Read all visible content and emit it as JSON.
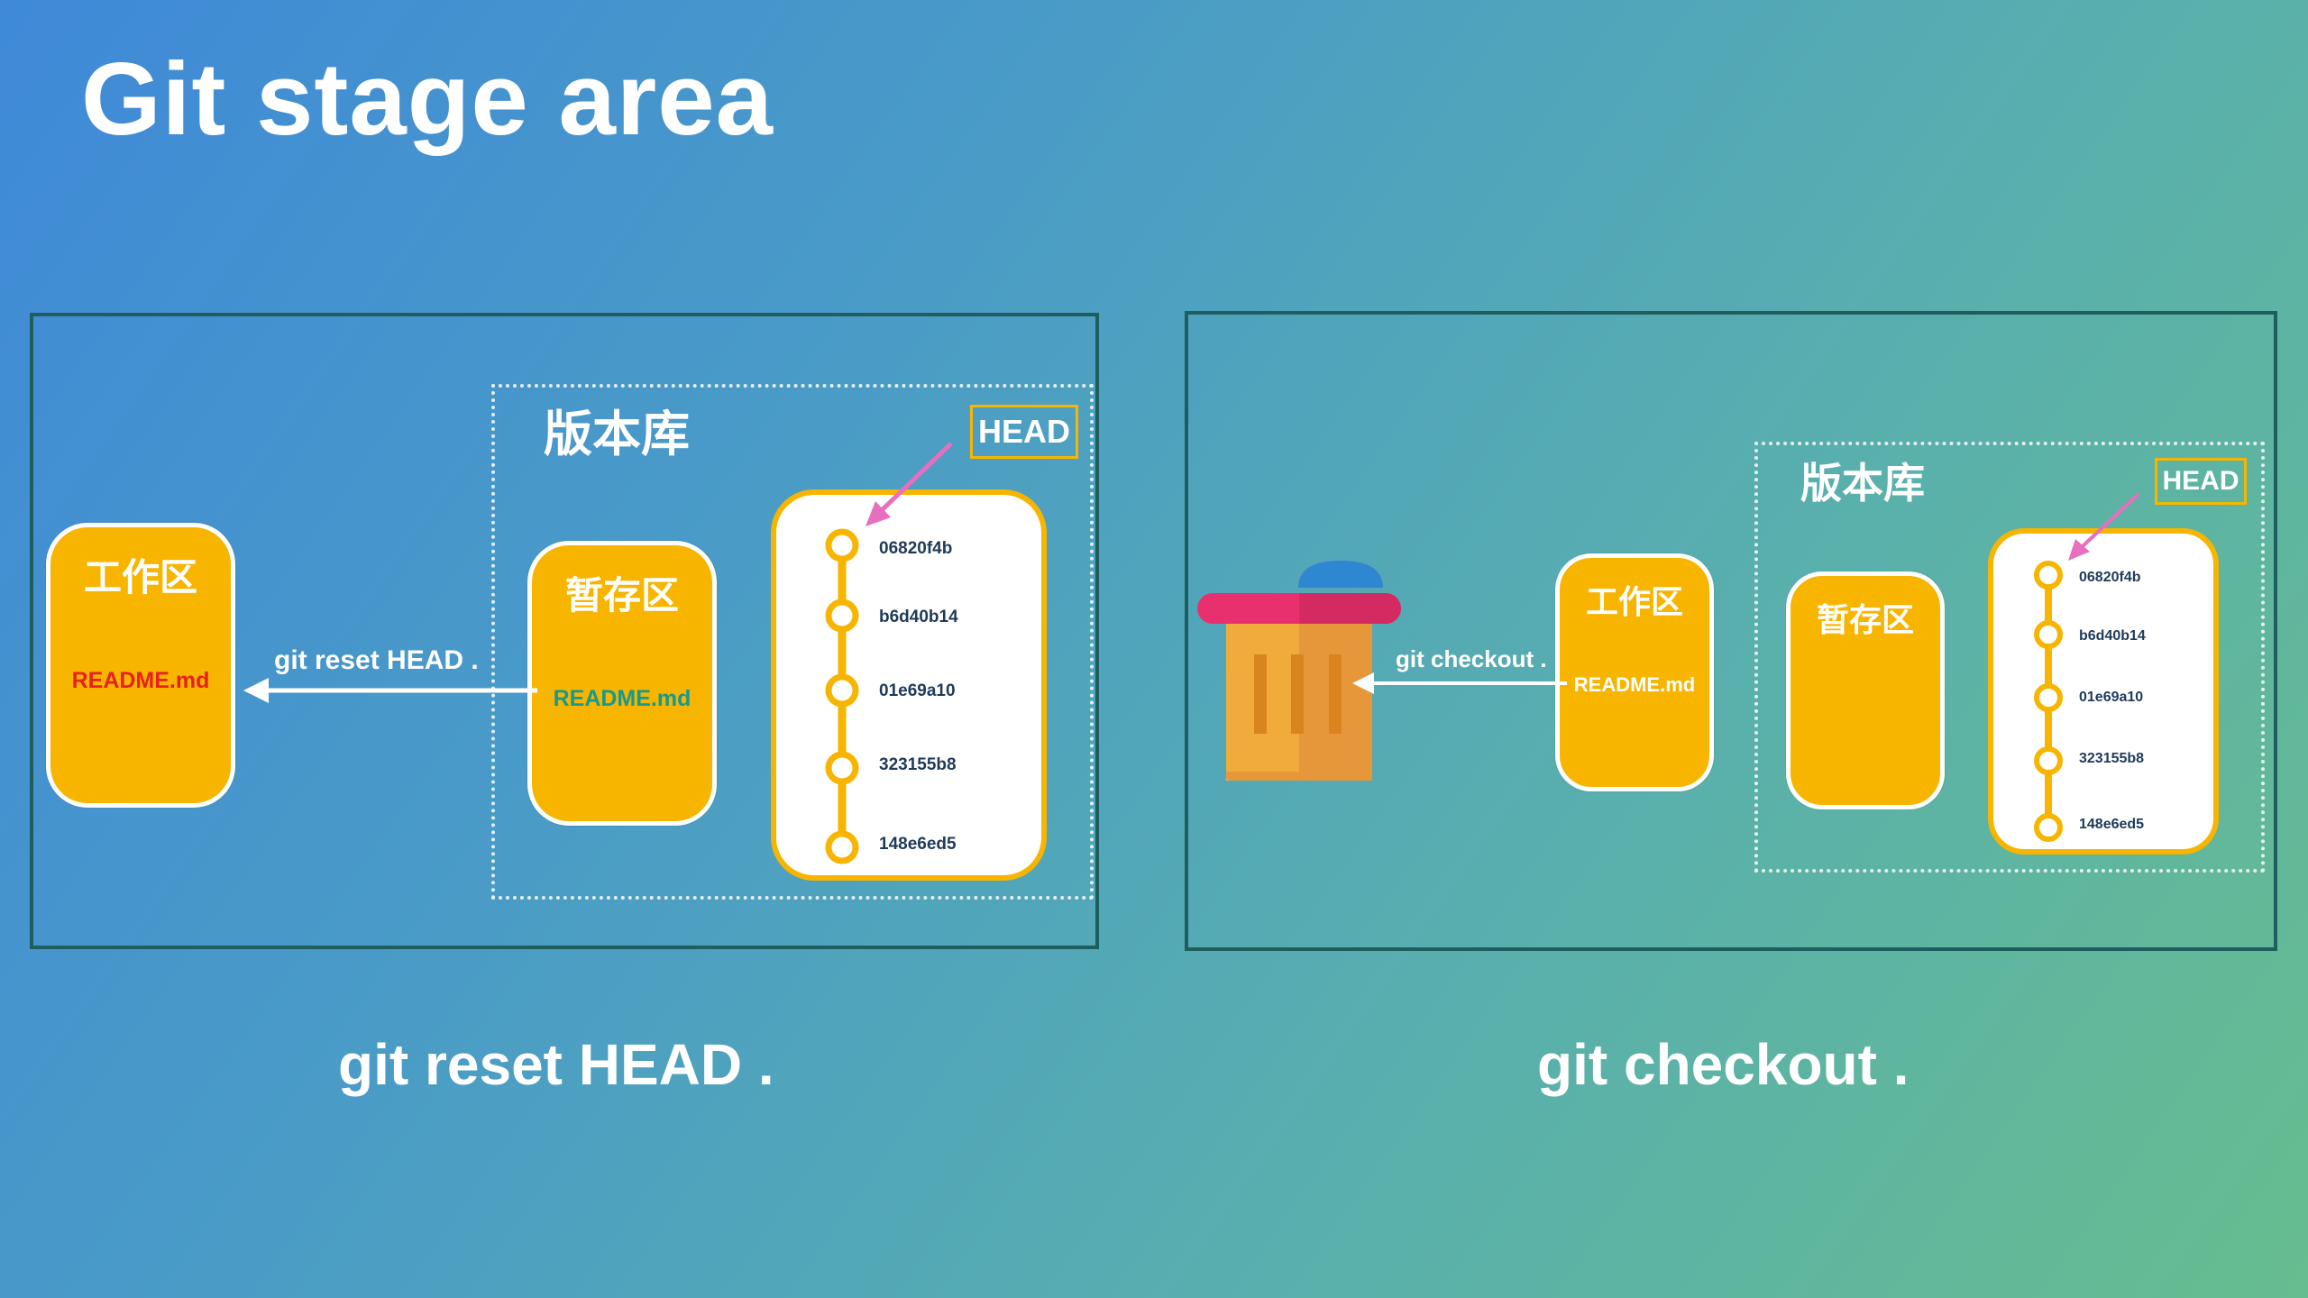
{
  "title": "Git stage area",
  "left": {
    "repo_label": "版本库",
    "head_label": "HEAD",
    "workspace_label": "工作区",
    "workspace_file": "README.md",
    "stage_label": "暂存区",
    "stage_file": "README.md",
    "arrow_label": "git reset HEAD .",
    "commits": [
      "06820f4b",
      "b6d40b14",
      "01e69a10",
      "323155b8",
      "148e6ed5"
    ],
    "caption": "git reset HEAD ."
  },
  "right": {
    "repo_label": "版本库",
    "head_label": "HEAD",
    "workspace_label": "工作区",
    "workspace_file": "README.md",
    "stage_label": "暂存区",
    "arrow_label": "git checkout .",
    "commits": [
      "06820f4b",
      "b6d40b14",
      "01e69a10",
      "323155b8",
      "148e6ed5"
    ],
    "caption": "git checkout ."
  },
  "colors": {
    "accent_yellow": "#f7b500",
    "head_arrow": "#e86fbf",
    "file_red": "#e8201f",
    "file_teal": "#169a8f",
    "commit_text": "#1f3a5a",
    "frame_border": "#1f5e5e"
  },
  "icons": {
    "trash": "trash-can-icon"
  }
}
